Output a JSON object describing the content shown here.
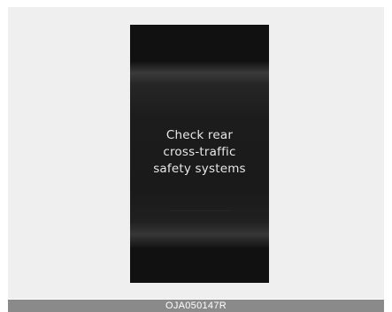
{
  "display": {
    "message_lines": [
      "Check rear",
      "cross-traffic",
      "safety systems"
    ]
  },
  "caption": {
    "code": "OJA050147R"
  },
  "colors": {
    "frame_background": "#efefef",
    "display_background": "#111111",
    "message_text": "#e8e8e8",
    "caption_bar": "#8a8a8a",
    "caption_text": "#ffffff"
  }
}
